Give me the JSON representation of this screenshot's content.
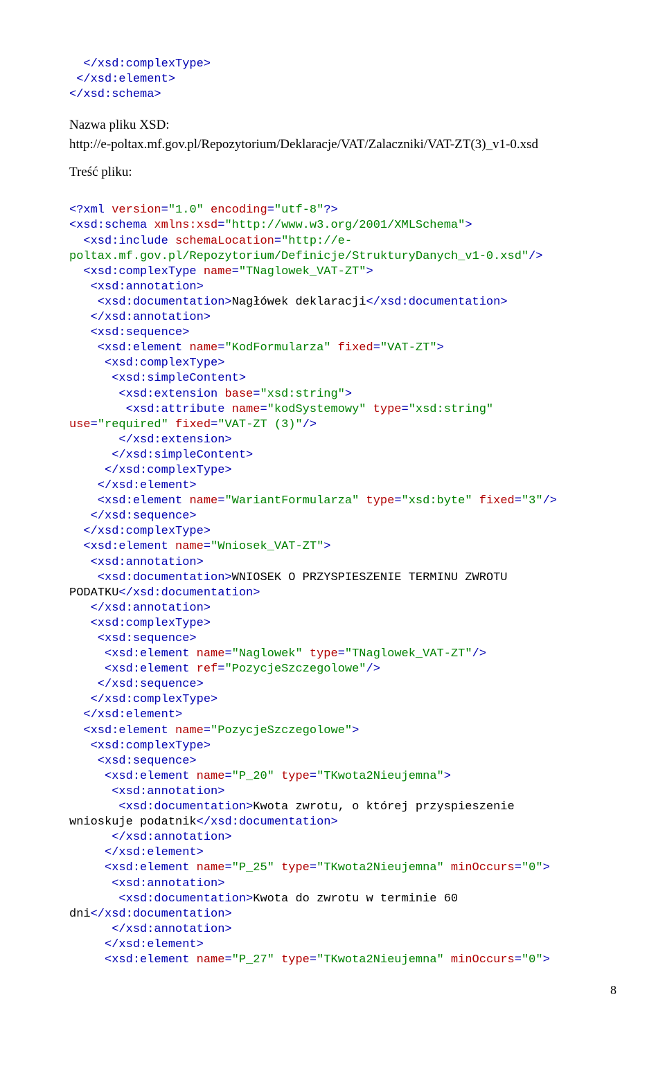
{
  "header_close": {
    "l1": "  </xsd:complexType>",
    "l2": " </xsd:element>",
    "l3": "</xsd:schema>"
  },
  "intro": {
    "nazwa_label": "Nazwa pliku XSD:",
    "nazwa_url": "http://e-poltax.mf.gov.pl/Repozytorium/Deklaracje/VAT/Zalaczniki/VAT-ZT(3)_v1-0.xsd",
    "tresc_label": "Treść pliku:"
  },
  "code": {
    "xmldecl_prefix": "<?xml ",
    "version_attr": "version",
    "version_eq": "=",
    "version_val": "\"1.0\"",
    "encoding_attr": " encoding",
    "encoding_eq": "=",
    "encoding_val": "\"utf-8\"",
    "xmldecl_suffix": "?>",
    "schema_open_a": "<xsd:schema ",
    "schema_open_b": "xmlns:xsd",
    "schema_open_eq": "=",
    "schema_open_val": "\"http://www.w3.org/2001/XMLSchema\"",
    "schema_open_end": ">",
    "include_a": "  <xsd:include ",
    "include_b": "schemaLocation",
    "include_eq": "=",
    "include_val_l1": "\"http://e-",
    "include_val_l2": "poltax.mf.gov.pl/Repozytorium/Definicje/StrukturyDanych_v1-0.xsd\"",
    "include_end": "/>",
    "ct_open_a": "  <xsd:complexType ",
    "ct_open_b": "name",
    "ct_open_eq": "=",
    "ct_open_val": "\"TNaglowek_VAT-ZT\"",
    "ct_open_end": ">",
    "ann_open_1": "   <xsd:annotation>",
    "doc_open_1": "    <xsd:documentation>",
    "doc_text_1": "Nagłówek deklaracji",
    "doc_close_1": "</xsd:documentation>",
    "ann_close_1": "   </xsd:annotation>",
    "seq_open_1": "   <xsd:sequence>",
    "el_kf_a": "    <xsd:element ",
    "el_kf_b": "name",
    "el_kf_eq1": "=",
    "el_kf_v1": "\"KodFormularza\"",
    "el_kf_c": " fixed",
    "el_kf_eq2": "=",
    "el_kf_v2": "\"VAT-ZT\"",
    "el_kf_end": ">",
    "ct_inner_open": "     <xsd:complexType>",
    "sc_open": "      <xsd:simpleContent>",
    "ext_open_a": "       <xsd:extension ",
    "ext_open_b": "base",
    "ext_open_eq": "=",
    "ext_open_val": "\"xsd:string\"",
    "ext_open_end": ">",
    "attr_a": "        <xsd:attribute ",
    "attr_b": "name",
    "attr_eq1": "=",
    "attr_v1": "\"kodSystemowy\"",
    "attr_c": " type",
    "attr_eq2": "=",
    "attr_v2": "\"xsd:string\"",
    "attr_l2_a": "use",
    "attr_l2_eq1": "=",
    "attr_l2_v1": "\"required\"",
    "attr_l2_b": " fixed",
    "attr_l2_eq2": "=",
    "attr_l2_v2": "\"VAT-ZT (3)\"",
    "attr_l2_end": "/>",
    "ext_close": "       </xsd:extension>",
    "sc_close": "      </xsd:simpleContent>",
    "ct_inner_close": "     </xsd:complexType>",
    "el_kf_close": "    </xsd:element>",
    "el_wf_a": "    <xsd:element ",
    "el_wf_b": "name",
    "el_wf_eq1": "=",
    "el_wf_v1": "\"WariantFormularza\"",
    "el_wf_c": " type",
    "el_wf_eq2": "=",
    "el_wf_v2": "\"xsd:byte\"",
    "el_wf_d": " fixed",
    "el_wf_eq3": "=",
    "el_wf_v3": "\"3\"",
    "el_wf_end": "/>",
    "seq_close_1": "   </xsd:sequence>",
    "ct_close_1": "  </xsd:complexType>",
    "el_wn_a": "  <xsd:element ",
    "el_wn_b": "name",
    "el_wn_eq": "=",
    "el_wn_val": "\"Wniosek_VAT-ZT\"",
    "el_wn_end": ">",
    "ann_open_2": "   <xsd:annotation>",
    "doc_open_2": "    <xsd:documentation>",
    "doc_text_2a": "WNIOSEK O PRZYSPIESZENIE TERMINU ZWROTU",
    "doc_text_2b": "PODATKU",
    "doc_close_2": "</xsd:documentation>",
    "ann_close_2": "   </xsd:annotation>",
    "ct_open2": "   <xsd:complexType>",
    "seq_open2": "    <xsd:sequence>",
    "el_ng_a": "     <xsd:element ",
    "el_ng_b": "name",
    "el_ng_eq1": "=",
    "el_ng_v1": "\"Naglowek\"",
    "el_ng_c": " type",
    "el_ng_eq2": "=",
    "el_ng_v2": "\"TNaglowek_VAT-ZT\"",
    "el_ng_end": "/>",
    "el_ps_a": "     <xsd:element ",
    "el_ps_b": "ref",
    "el_ps_eq": "=",
    "el_ps_v": "\"PozycjeSzczegolowe\"",
    "el_ps_end": "/>",
    "seq_close2": "    </xsd:sequence>",
    "ct_close2": "   </xsd:complexType>",
    "el_wn_close": "  </xsd:element>",
    "el_psz_a": "  <xsd:element ",
    "el_psz_b": "name",
    "el_psz_eq": "=",
    "el_psz_val": "\"PozycjeSzczegolowe\"",
    "el_psz_end": ">",
    "ct_open3": "   <xsd:complexType>",
    "seq_open3": "    <xsd:sequence>",
    "el_p20_a": "     <xsd:element ",
    "el_p20_b": "name",
    "el_p20_eq1": "=",
    "el_p20_v1": "\"P_20\"",
    "el_p20_c": " type",
    "el_p20_eq2": "=",
    "el_p20_v2": "\"TKwota2Nieujemna\"",
    "el_p20_end": ">",
    "ann_open_3": "      <xsd:annotation>",
    "doc_open_3": "       <xsd:documentation>",
    "doc_text_3a": "Kwota zwrotu, o której przyspieszenie",
    "doc_text_3b": "wnioskuje podatnik",
    "doc_close_3": "</xsd:documentation>",
    "ann_close_3": "      </xsd:annotation>",
    "el_p20_close": "     </xsd:element>",
    "el_p25_a": "     <xsd:element ",
    "el_p25_b": "name",
    "el_p25_eq1": "=",
    "el_p25_v1": "\"P_25\"",
    "el_p25_c": " type",
    "el_p25_eq2": "=",
    "el_p25_v2": "\"TKwota2Nieujemna\"",
    "el_p25_d": " minOccurs",
    "el_p25_eq3": "=",
    "el_p25_v3": "\"0\"",
    "el_p25_end": ">",
    "ann_open_4": "      <xsd:annotation>",
    "doc_open_4": "       <xsd:documentation>",
    "doc_text_4a": "Kwota do zwrotu w terminie 60",
    "doc_text_4b": "dni",
    "doc_close_4": "</xsd:documentation>",
    "ann_close_4": "      </xsd:annotation>",
    "el_p25_close": "     </xsd:element>",
    "el_p27_a": "     <xsd:element ",
    "el_p27_b": "name",
    "el_p27_eq1": "=",
    "el_p27_v1": "\"P_27\"",
    "el_p27_c": " type",
    "el_p27_eq2": "=",
    "el_p27_v2": "\"TKwota2Nieujemna\"",
    "el_p27_d": " minOccurs",
    "el_p27_eq3": "=",
    "el_p27_v3": "\"0\"",
    "el_p27_end": ">"
  },
  "page_number": "8"
}
